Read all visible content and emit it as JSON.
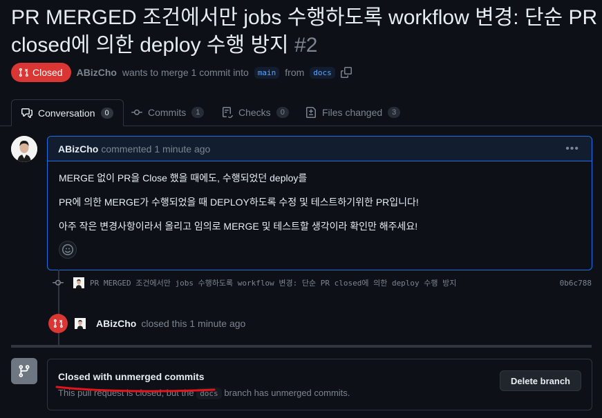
{
  "pr": {
    "title": "PR MERGED 조건에서만 jobs 수행하도록 workflow 변경: 단순 PR closed에 의한 deploy 수행 방지",
    "number": "#2",
    "state": "Closed",
    "author": "ABizCho",
    "merge_text": "wants to merge 1 commit into",
    "base_branch": "main",
    "from_text": "from",
    "head_branch": "docs"
  },
  "tabs": [
    {
      "label": "Conversation",
      "count": "0",
      "icon": "comment-discussion-icon"
    },
    {
      "label": "Commits",
      "count": "1",
      "icon": "git-commit-icon"
    },
    {
      "label": "Checks",
      "count": "0",
      "icon": "checklist-icon"
    },
    {
      "label": "Files changed",
      "count": "3",
      "icon": "file-diff-icon"
    }
  ],
  "comment": {
    "author": "ABizCho",
    "meta": "commented 1 minute ago",
    "lines": [
      "MERGE 없이 PR을 Close 했을 때에도, 수행되었던 deploy를",
      "PR에 의한 MERGE가 수행되었을 때 DEPLOY하도록 수정 및 테스트하기위한 PR입니다!",
      "아주 작은 변경사항이라서 올리고 임의로 MERGE 및 테스트할 생각이라 확인만 해주세요!"
    ]
  },
  "commit": {
    "message": "PR MERGED 조건에서만 jobs 수행하도록 workflow 변경: 단순 PR closed에 의한 deploy 수행 방지",
    "sha": "0b6c788"
  },
  "closed_event": {
    "author": "ABizCho",
    "text": "closed this 1 minute ago"
  },
  "merge_box": {
    "title": "Closed with unmerged commits",
    "sub_before": "This pull request is closed, but the",
    "branch": "docs",
    "sub_after": "branch has unmerged commits.",
    "delete_label": "Delete branch"
  },
  "colors": {
    "closed_red": "#da3633",
    "accent_blue": "#1f6feb",
    "annotation_red": "#e5141b"
  }
}
